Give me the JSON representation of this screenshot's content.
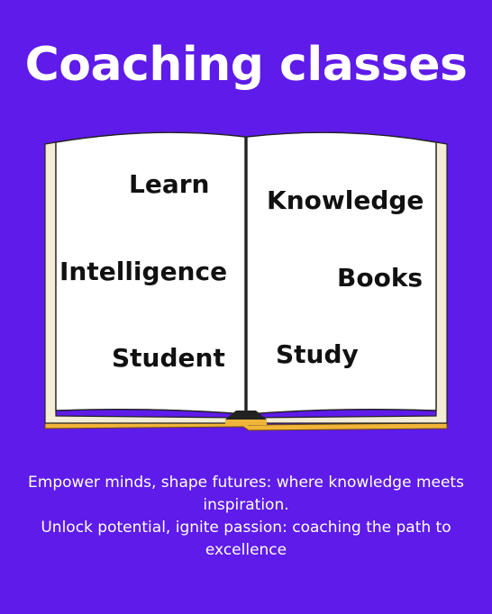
{
  "title": "Coaching classes",
  "words": {
    "learn": "Learn",
    "knowledge": "Knowledge",
    "intelligence": "Intelligence",
    "books": "Books",
    "student": "Student",
    "study": "Study"
  },
  "caption": {
    "line1": "Empower minds, shape futures: where knowledge meets inspiration.",
    "line2": "Unlock potential, ignite passion: coaching the path to excellence"
  },
  "colors": {
    "background": "#5e1be9",
    "page": "#ffffff",
    "page_edge": "#f3ecd6",
    "cover": "#f0b43a"
  }
}
